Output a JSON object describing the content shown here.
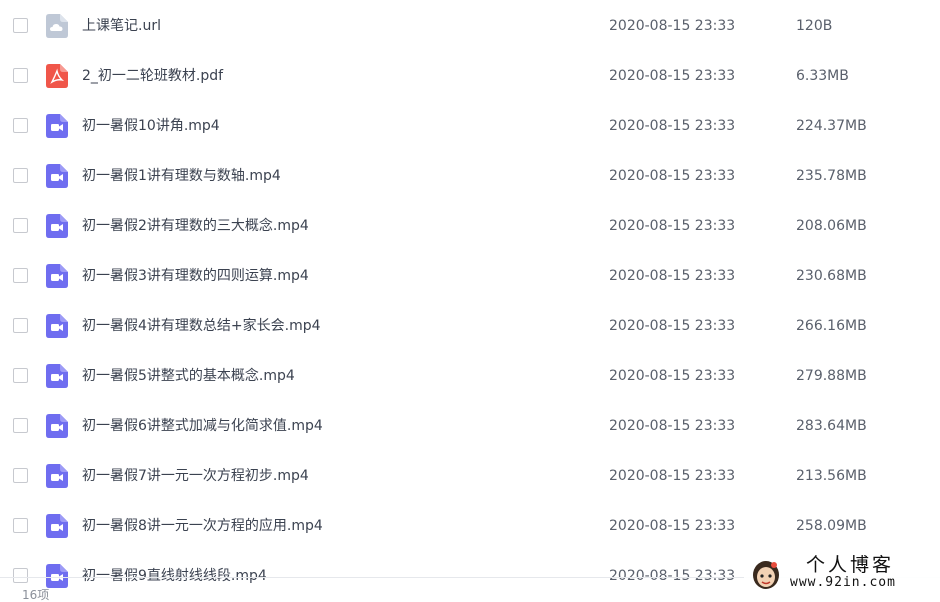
{
  "files": [
    {
      "type": "url",
      "name": "上课笔记.url",
      "date": "2020-08-15 23:33",
      "size": "120B"
    },
    {
      "type": "pdf",
      "name": "2_初一二轮班教材.pdf",
      "date": "2020-08-15 23:33",
      "size": "6.33MB"
    },
    {
      "type": "video",
      "name": "初一暑假10讲角.mp4",
      "date": "2020-08-15 23:33",
      "size": "224.37MB"
    },
    {
      "type": "video",
      "name": "初一暑假1讲有理数与数轴.mp4",
      "date": "2020-08-15 23:33",
      "size": "235.78MB"
    },
    {
      "type": "video",
      "name": "初一暑假2讲有理数的三大概念.mp4",
      "date": "2020-08-15 23:33",
      "size": "208.06MB"
    },
    {
      "type": "video",
      "name": "初一暑假3讲有理数的四则运算.mp4",
      "date": "2020-08-15 23:33",
      "size": "230.68MB"
    },
    {
      "type": "video",
      "name": "初一暑假4讲有理数总结+家长会.mp4",
      "date": "2020-08-15 23:33",
      "size": "266.16MB"
    },
    {
      "type": "video",
      "name": "初一暑假5讲整式的基本概念.mp4",
      "date": "2020-08-15 23:33",
      "size": "279.88MB"
    },
    {
      "type": "video",
      "name": "初一暑假6讲整式加减与化简求值.mp4",
      "date": "2020-08-15 23:33",
      "size": "283.64MB"
    },
    {
      "type": "video",
      "name": "初一暑假7讲一元一次方程初步.mp4",
      "date": "2020-08-15 23:33",
      "size": "213.56MB"
    },
    {
      "type": "video",
      "name": "初一暑假8讲一元一次方程的应用.mp4",
      "date": "2020-08-15 23:33",
      "size": "258.09MB"
    },
    {
      "type": "video",
      "name": "初一暑假9直线射线线段.mp4",
      "date": "2020-08-15 23:33",
      "size": ""
    }
  ],
  "footer": {
    "count": "16项"
  },
  "watermark": {
    "title": "个人博客",
    "url": "www.92in.com"
  },
  "colors": {
    "video": "#6f6df0",
    "pdf": "#f0564a",
    "url": "#bfc8d6"
  }
}
